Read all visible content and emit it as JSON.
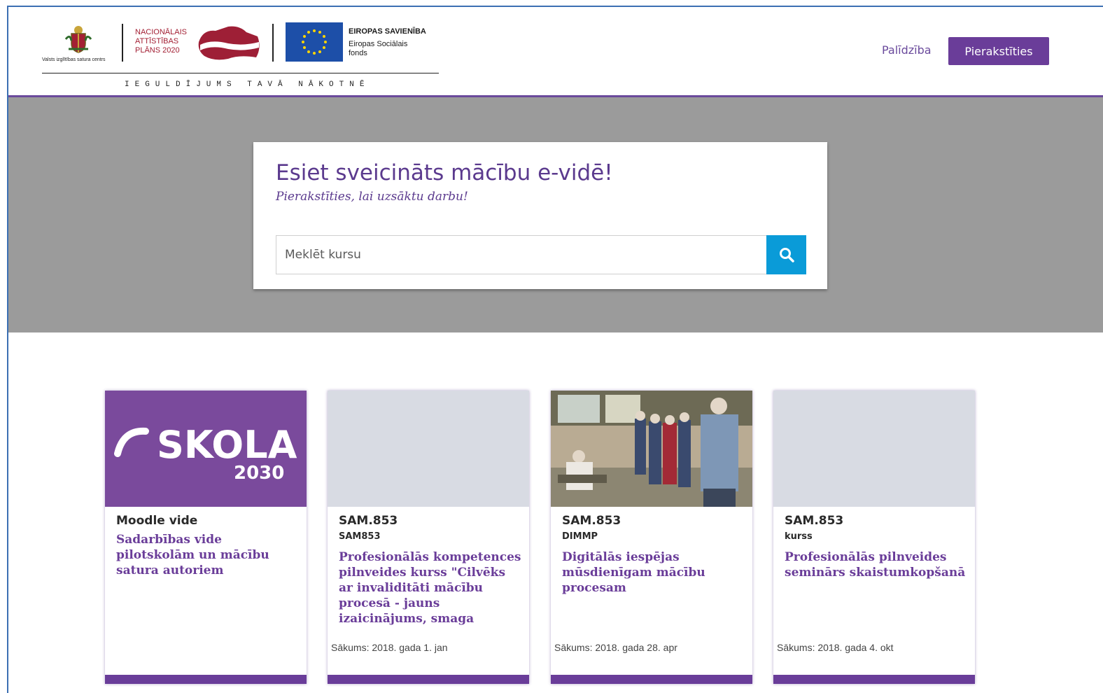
{
  "header": {
    "coat_label": "Valsts izglītības satura centrs",
    "nap_lines": [
      "NACIONĀLAIS",
      "ATTĪSTĪBAS",
      "PLĀNS 2020"
    ],
    "eu_title": "EIROPAS SAVIENĪBA",
    "eu_sub": "Eiropas Sociālais fonds",
    "tagline": "IEGULDĪJUMS TAVĀ NĀKOTNĒ",
    "help_label": "Palīdzība",
    "login_label": "Pierakstīties"
  },
  "hero": {
    "title": "Esiet sveicināts mācību e-vidē!",
    "subtitle": "Pierakstīties, lai uzsāktu darbu!",
    "search_placeholder": "Meklēt kursu"
  },
  "cards": [
    {
      "code": "Moodle vide",
      "short": "",
      "title": "Sadarbības vide pilotskolām un mācību satura autoriem",
      "start": "",
      "image": "skola-2030-logo",
      "logo_text": "SKOLA",
      "logo_year": "2030"
    },
    {
      "code": "SAM.853",
      "short": "SAM853",
      "title": "Profesionālās kompetences pilnveides kurss \"Cilvēks ar invaliditāti mācību procesā - jauns izaicinājums, smaga",
      "start": "Sākums: 2018. gada 1. jan",
      "image": "placeholder"
    },
    {
      "code": "SAM.853",
      "short": "DIMMP",
      "title": "Digitālās iespējas mūsdienīgam mācību procesam",
      "start": "Sākums: 2018. gada 28. apr",
      "image": "workshop-photo"
    },
    {
      "code": "SAM.853",
      "short": "kurss",
      "title": "Profesionālās pilnveides seminārs skaistumkopšanā",
      "start": "Sākums: 2018. gada 4. okt",
      "image": "placeholder"
    }
  ],
  "colors": {
    "brand_purple": "#6a3d99",
    "search_blue": "#0a9bd8",
    "hero_gray": "#9b9b9b"
  }
}
